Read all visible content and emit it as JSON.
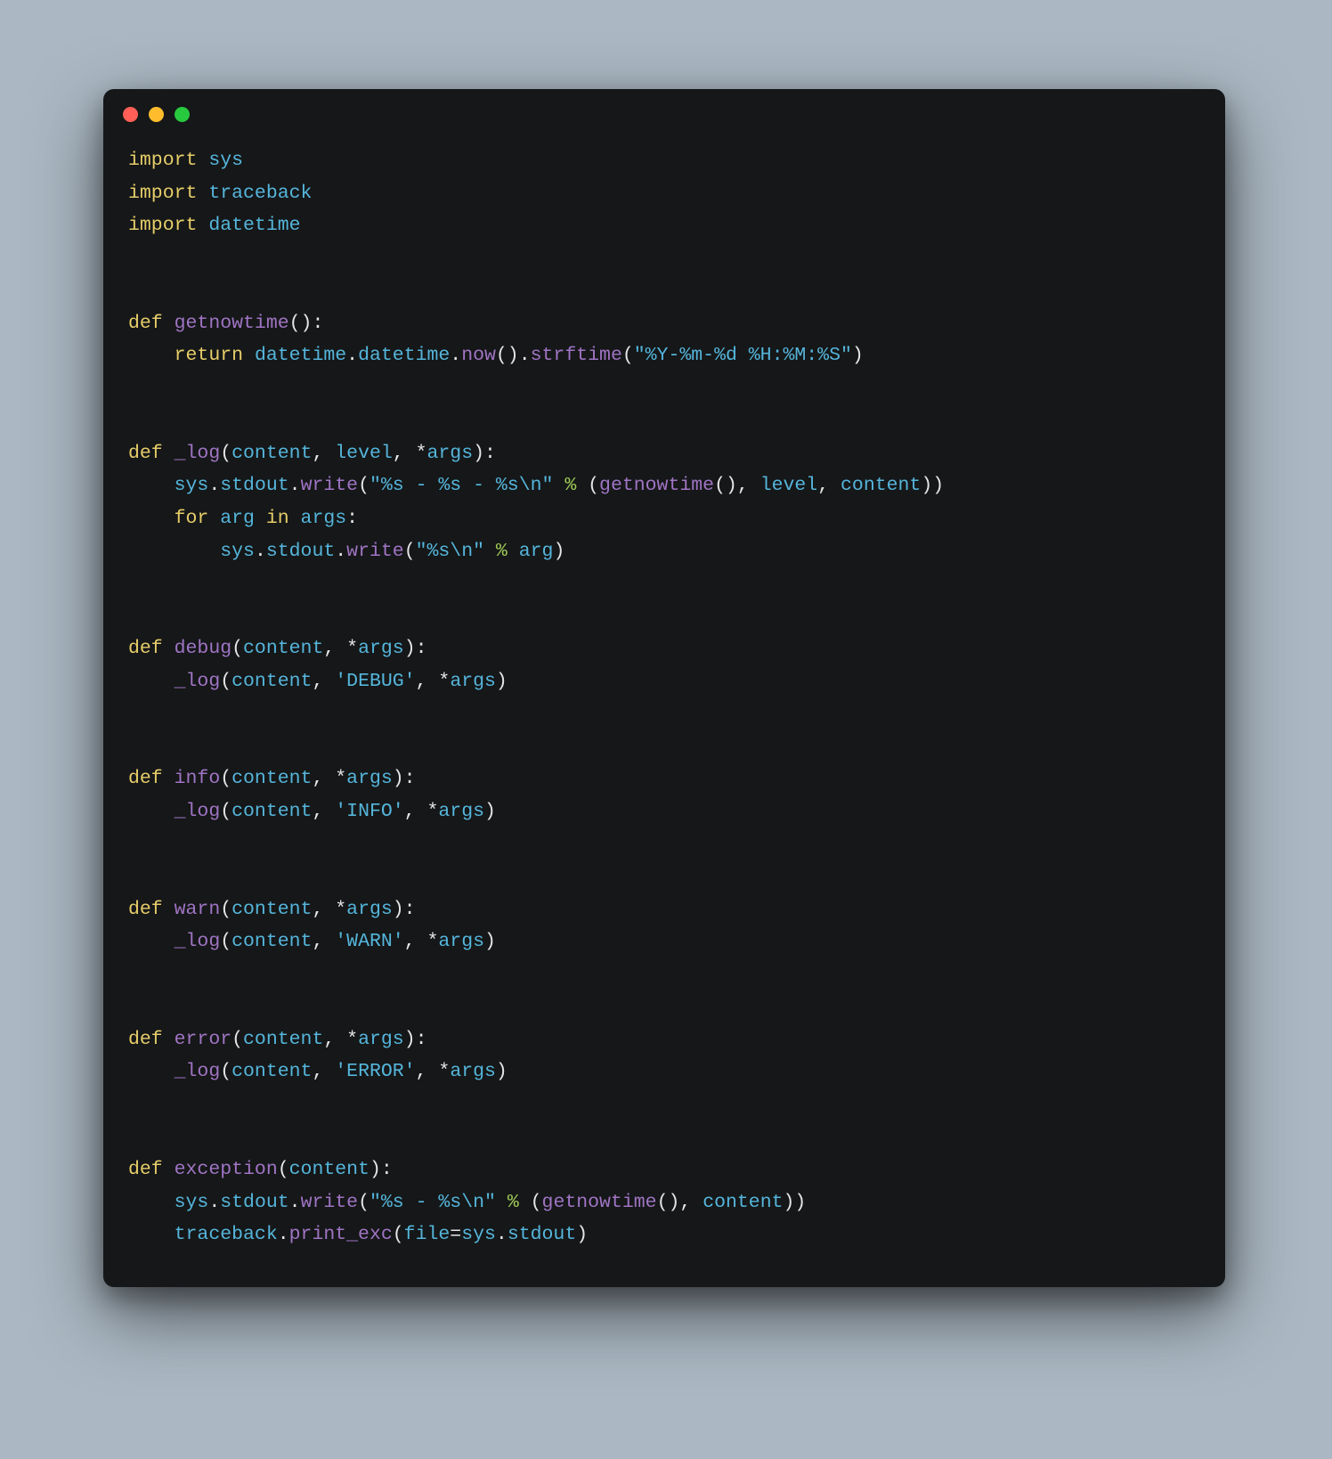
{
  "window": {
    "buttons": {
      "close": "red",
      "min": "yellow",
      "max": "green"
    }
  },
  "code": {
    "tokens": [
      [
        [
          "k",
          "import "
        ],
        [
          "nm",
          "sys"
        ]
      ],
      [
        [
          "k",
          "import "
        ],
        [
          "nm",
          "traceback"
        ]
      ],
      [
        [
          "k",
          "import "
        ],
        [
          "nm",
          "datetime"
        ]
      ],
      [],
      [],
      [
        [
          "k",
          "def "
        ],
        [
          "fn",
          "getnowtime"
        ],
        [
          "p",
          "():"
        ]
      ],
      [
        [
          "p",
          "    "
        ],
        [
          "k",
          "return "
        ],
        [
          "nm",
          "datetime"
        ],
        [
          "p",
          "."
        ],
        [
          "nm",
          "datetime"
        ],
        [
          "p",
          "."
        ],
        [
          "fn",
          "now"
        ],
        [
          "p",
          "()"
        ],
        [
          "p",
          "."
        ],
        [
          "fn",
          "strftime"
        ],
        [
          "p",
          "("
        ],
        [
          "str",
          "\"%Y-%m-%d %H:%M:%S\""
        ],
        [
          "p",
          ")"
        ]
      ],
      [],
      [],
      [
        [
          "k",
          "def "
        ],
        [
          "fn",
          "_log"
        ],
        [
          "p",
          "("
        ],
        [
          "nm",
          "content"
        ],
        [
          "p",
          ", "
        ],
        [
          "nm",
          "level"
        ],
        [
          "p",
          ", "
        ],
        [
          "p",
          "*"
        ],
        [
          "nm",
          "args"
        ],
        [
          "p",
          "):"
        ]
      ],
      [
        [
          "p",
          "    "
        ],
        [
          "nm",
          "sys"
        ],
        [
          "p",
          "."
        ],
        [
          "nm",
          "stdout"
        ],
        [
          "p",
          "."
        ],
        [
          "fn",
          "write"
        ],
        [
          "p",
          "("
        ],
        [
          "str",
          "\"%s - %s - %s\\n\""
        ],
        [
          "p",
          " "
        ],
        [
          "op",
          "%"
        ],
        [
          "p",
          " ("
        ],
        [
          "fn",
          "getnowtime"
        ],
        [
          "p",
          "(), "
        ],
        [
          "nm",
          "level"
        ],
        [
          "p",
          ", "
        ],
        [
          "nm",
          "content"
        ],
        [
          "p",
          "))"
        ]
      ],
      [
        [
          "p",
          "    "
        ],
        [
          "k",
          "for "
        ],
        [
          "nm",
          "arg"
        ],
        [
          "k",
          " in "
        ],
        [
          "nm",
          "args"
        ],
        [
          "p",
          ":"
        ]
      ],
      [
        [
          "p",
          "        "
        ],
        [
          "nm",
          "sys"
        ],
        [
          "p",
          "."
        ],
        [
          "nm",
          "stdout"
        ],
        [
          "p",
          "."
        ],
        [
          "fn",
          "write"
        ],
        [
          "p",
          "("
        ],
        [
          "str",
          "\"%s\\n\""
        ],
        [
          "p",
          " "
        ],
        [
          "op",
          "%"
        ],
        [
          "p",
          " "
        ],
        [
          "nm",
          "arg"
        ],
        [
          "p",
          ")"
        ]
      ],
      [],
      [],
      [
        [
          "k",
          "def "
        ],
        [
          "fn",
          "debug"
        ],
        [
          "p",
          "("
        ],
        [
          "nm",
          "content"
        ],
        [
          "p",
          ", "
        ],
        [
          "p",
          "*"
        ],
        [
          "nm",
          "args"
        ],
        [
          "p",
          "):"
        ]
      ],
      [
        [
          "p",
          "    "
        ],
        [
          "fn",
          "_log"
        ],
        [
          "p",
          "("
        ],
        [
          "nm",
          "content"
        ],
        [
          "p",
          ", "
        ],
        [
          "str",
          "'DEBUG'"
        ],
        [
          "p",
          ", "
        ],
        [
          "p",
          "*"
        ],
        [
          "nm",
          "args"
        ],
        [
          "p",
          ")"
        ]
      ],
      [],
      [],
      [
        [
          "k",
          "def "
        ],
        [
          "fn",
          "info"
        ],
        [
          "p",
          "("
        ],
        [
          "nm",
          "content"
        ],
        [
          "p",
          ", "
        ],
        [
          "p",
          "*"
        ],
        [
          "nm",
          "args"
        ],
        [
          "p",
          "):"
        ]
      ],
      [
        [
          "p",
          "    "
        ],
        [
          "fn",
          "_log"
        ],
        [
          "p",
          "("
        ],
        [
          "nm",
          "content"
        ],
        [
          "p",
          ", "
        ],
        [
          "str",
          "'INFO'"
        ],
        [
          "p",
          ", "
        ],
        [
          "p",
          "*"
        ],
        [
          "nm",
          "args"
        ],
        [
          "p",
          ")"
        ]
      ],
      [],
      [],
      [
        [
          "k",
          "def "
        ],
        [
          "fn",
          "warn"
        ],
        [
          "p",
          "("
        ],
        [
          "nm",
          "content"
        ],
        [
          "p",
          ", "
        ],
        [
          "p",
          "*"
        ],
        [
          "nm",
          "args"
        ],
        [
          "p",
          "):"
        ]
      ],
      [
        [
          "p",
          "    "
        ],
        [
          "fn",
          "_log"
        ],
        [
          "p",
          "("
        ],
        [
          "nm",
          "content"
        ],
        [
          "p",
          ", "
        ],
        [
          "str",
          "'WARN'"
        ],
        [
          "p",
          ", "
        ],
        [
          "p",
          "*"
        ],
        [
          "nm",
          "args"
        ],
        [
          "p",
          ")"
        ]
      ],
      [],
      [],
      [
        [
          "k",
          "def "
        ],
        [
          "fn",
          "error"
        ],
        [
          "p",
          "("
        ],
        [
          "nm",
          "content"
        ],
        [
          "p",
          ", "
        ],
        [
          "p",
          "*"
        ],
        [
          "nm",
          "args"
        ],
        [
          "p",
          "):"
        ]
      ],
      [
        [
          "p",
          "    "
        ],
        [
          "fn",
          "_log"
        ],
        [
          "p",
          "("
        ],
        [
          "nm",
          "content"
        ],
        [
          "p",
          ", "
        ],
        [
          "str",
          "'ERROR'"
        ],
        [
          "p",
          ", "
        ],
        [
          "p",
          "*"
        ],
        [
          "nm",
          "args"
        ],
        [
          "p",
          ")"
        ]
      ],
      [],
      [],
      [
        [
          "k",
          "def "
        ],
        [
          "fn",
          "exception"
        ],
        [
          "p",
          "("
        ],
        [
          "nm",
          "content"
        ],
        [
          "p",
          "):"
        ]
      ],
      [
        [
          "p",
          "    "
        ],
        [
          "nm",
          "sys"
        ],
        [
          "p",
          "."
        ],
        [
          "nm",
          "stdout"
        ],
        [
          "p",
          "."
        ],
        [
          "fn",
          "write"
        ],
        [
          "p",
          "("
        ],
        [
          "str",
          "\"%s - %s\\n\""
        ],
        [
          "p",
          " "
        ],
        [
          "op",
          "%"
        ],
        [
          "p",
          " ("
        ],
        [
          "fn",
          "getnowtime"
        ],
        [
          "p",
          "(), "
        ],
        [
          "nm",
          "content"
        ],
        [
          "p",
          "))"
        ]
      ],
      [
        [
          "p",
          "    "
        ],
        [
          "nm",
          "traceback"
        ],
        [
          "p",
          "."
        ],
        [
          "fn",
          "print_exc"
        ],
        [
          "p",
          "("
        ],
        [
          "nm",
          "file"
        ],
        [
          "p",
          "="
        ],
        [
          "nm",
          "sys"
        ],
        [
          "p",
          "."
        ],
        [
          "nm",
          "stdout"
        ],
        [
          "p",
          ")"
        ]
      ]
    ]
  }
}
